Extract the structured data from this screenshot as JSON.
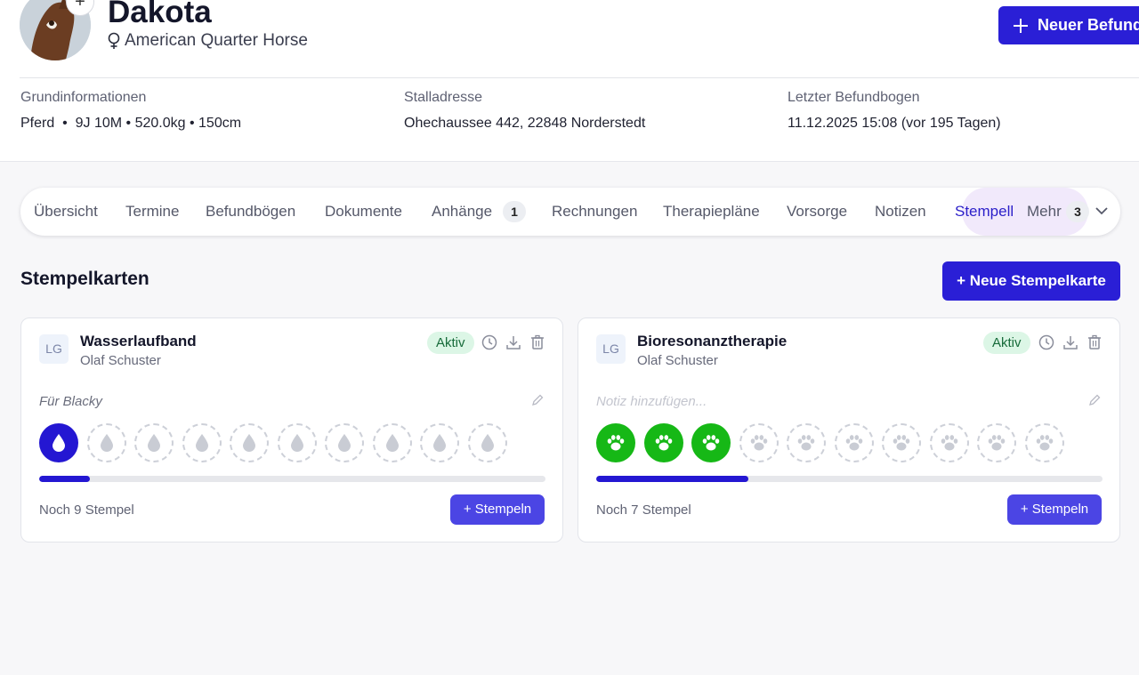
{
  "header": {
    "pet_name": "Dakota",
    "breed": "American Quarter Horse",
    "new_report_label": "Neuer Befund"
  },
  "info": {
    "basic": {
      "label": "Grundinformationen",
      "value": "Pferd  •  9J 10M • 520.0kg • 150cm"
    },
    "stable": {
      "label": "Stalladresse",
      "value": "Ohechaussee 442, 22848 Norderstedt"
    },
    "last_report": {
      "label": "Letzter Befundbogen",
      "value": "11.12.2025 15:08 (vor 195 Tagen)"
    }
  },
  "tabs": [
    {
      "label": "Übersicht"
    },
    {
      "label": "Termine"
    },
    {
      "label": "Befundbögen"
    },
    {
      "label": "Dokumente"
    },
    {
      "label": "Anhänge",
      "badge": "1"
    },
    {
      "label": "Rechnungen"
    },
    {
      "label": "Therapiepläne"
    },
    {
      "label": "Vorsorge"
    },
    {
      "label": "Notizen"
    },
    {
      "label": "Stempell",
      "active": true
    },
    {
      "label": "Mehr",
      "badge": "3"
    }
  ],
  "section": {
    "title": "Stempelkarten",
    "new_card_label": "+ Neue Stempelkarte"
  },
  "cards": [
    {
      "initials": "LG",
      "title": "Wasserlaufband",
      "owner": "Olaf Schuster",
      "status": "Aktiv",
      "note": "Für Blacky",
      "total_stamps": 10,
      "filled_stamps": 1,
      "stamp_icon": "water-drop-icon",
      "fill_color": "#2417d2",
      "progress": 0.1,
      "remaining": "Noch 9 Stempel",
      "stamp_button": "+ Stempeln"
    },
    {
      "initials": "LG",
      "title": "Bioresonanztherapie",
      "owner": "Olaf Schuster",
      "status": "Aktiv",
      "note_placeholder": "Notiz hinzufügen...",
      "total_stamps": 10,
      "filled_stamps": 3,
      "stamp_icon": "paw-icon",
      "fill_color": "#16b816",
      "progress": 0.3,
      "remaining": "Noch 7 Stempel",
      "stamp_button": "+ Stempeln"
    }
  ],
  "colors": {
    "primary": "#2a1fd6",
    "active_tab_bg": "#f1e9fb",
    "status_bg": "#dcf6e6",
    "status_text": "#176b3a"
  }
}
